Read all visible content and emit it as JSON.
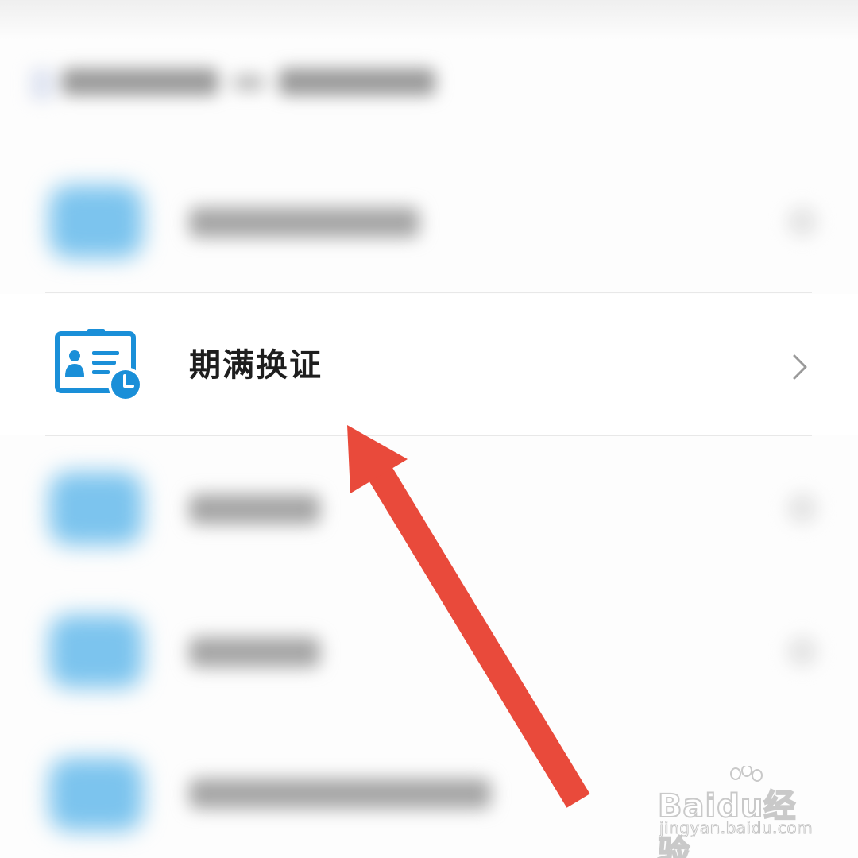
{
  "menu": {
    "focused_item": {
      "label": "期满换证",
      "icon": "id-card-clock-icon"
    }
  },
  "annotation": {
    "arrow_color": "#e94a3b"
  },
  "watermark": {
    "brand_latin": "Bai",
    "brand_du": "du",
    "brand_cn": "经验",
    "url": "jingyan.baidu.com"
  },
  "colors": {
    "icon_blue": "#1a8fd8",
    "text_dark": "#1e1e1e",
    "chevron": "#9a9a9a"
  }
}
